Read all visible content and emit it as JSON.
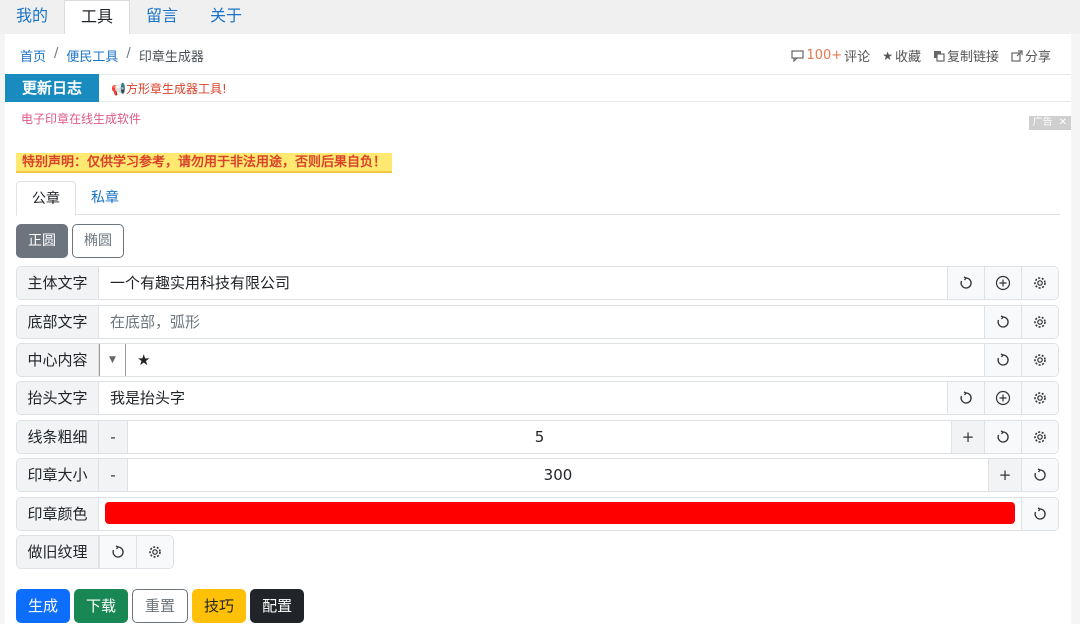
{
  "nav": {
    "tabs": [
      {
        "label": "我的"
      },
      {
        "label": "工具"
      },
      {
        "label": "留言"
      },
      {
        "label": "关于"
      }
    ],
    "active": 1
  },
  "breadcrumb": {
    "home": "首页",
    "category": "便民工具",
    "current": "印章生成器",
    "separator": "/"
  },
  "actions": {
    "comment_count": "100+",
    "comment_label": "评论",
    "favorite": "收藏",
    "copy_link": "复制链接",
    "share": "分享"
  },
  "changelog": {
    "label": "更新日志",
    "message": "方形章生成器工具!"
  },
  "ad": {
    "text": "电子印章在线生成软件",
    "badge": "广告",
    "close": "✕"
  },
  "notice": "特别声明：仅供学习参考，请勿用于非法用途，否则后果自负！",
  "seal_tabs": [
    {
      "label": "公章"
    },
    {
      "label": "私章"
    }
  ],
  "shapes": [
    {
      "label": "正圆"
    },
    {
      "label": "椭圆"
    }
  ],
  "fields": {
    "main_text": {
      "label": "主体文字",
      "value": "一个有趣实用科技有限公司"
    },
    "bottom_text": {
      "label": "底部文字",
      "placeholder": "在底部，弧形"
    },
    "center": {
      "label": "中心内容",
      "value": "★"
    },
    "header_text": {
      "label": "抬头文字",
      "value": "我是抬头字"
    },
    "line_width": {
      "label": "线条粗细",
      "value": "5",
      "minus": "-",
      "plus": "+"
    },
    "seal_size": {
      "label": "印章大小",
      "value": "300",
      "minus": "-",
      "plus": "+"
    },
    "seal_color": {
      "label": "印章颜色",
      "color": "#ff0000"
    },
    "aged_texture": {
      "label": "做旧纹理"
    }
  },
  "buttons": {
    "generate": "生成",
    "download": "下载",
    "reset": "重置",
    "tips": "技巧",
    "config": "配置"
  },
  "colors": {
    "link": "#1a73c8",
    "accent": "#1a8bbf",
    "danger": "#d9432c"
  }
}
